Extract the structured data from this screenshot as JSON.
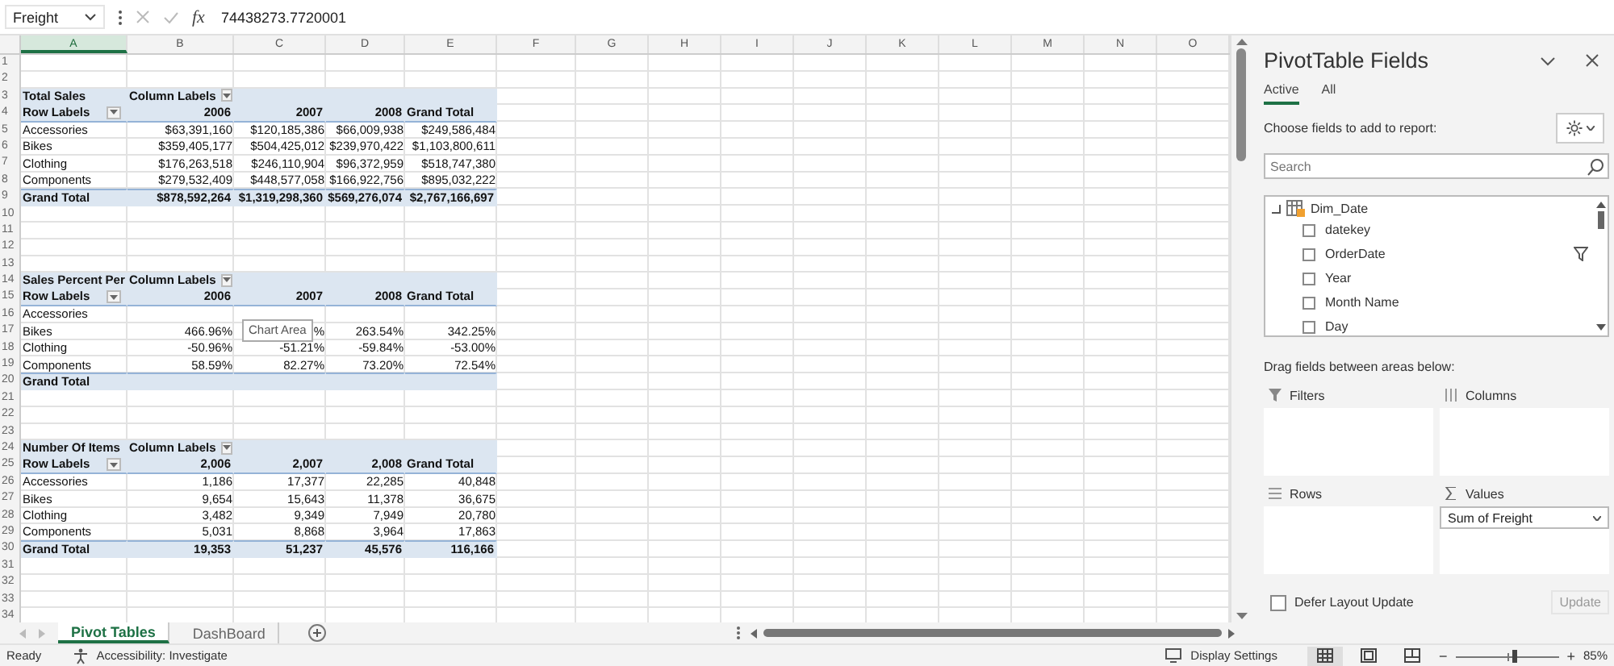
{
  "formula_bar": {
    "name_box": "Freight",
    "function_label": "fx",
    "value": "74438273.7720001"
  },
  "columns": [
    {
      "label": "A",
      "selected": true
    },
    {
      "label": "B",
      "selected": false
    },
    {
      "label": "C",
      "selected": false
    },
    {
      "label": "D",
      "selected": false
    },
    {
      "label": "E",
      "selected": false
    },
    {
      "label": "F",
      "selected": false
    },
    {
      "label": "G",
      "selected": false
    },
    {
      "label": "H",
      "selected": false
    },
    {
      "label": "I",
      "selected": false
    },
    {
      "label": "J",
      "selected": false
    },
    {
      "label": "K",
      "selected": false
    },
    {
      "label": "L",
      "selected": false
    },
    {
      "label": "M",
      "selected": false
    },
    {
      "label": "N",
      "selected": false
    },
    {
      "label": "O",
      "selected": false
    }
  ],
  "rows": [
    {
      "number": "1",
      "kind": "empty",
      "cells": []
    },
    {
      "number": "2",
      "kind": "empty",
      "cells": []
    },
    {
      "number": "3",
      "kind": "title",
      "cells": [
        "Total Sales",
        {
          "text": "Column Labels",
          "filter": true
        }
      ]
    },
    {
      "number": "4",
      "kind": "header",
      "cells": [
        {
          "text": "Row Labels",
          "filter": true
        },
        "2006",
        "2007",
        "2008",
        "Grand Total"
      ]
    },
    {
      "number": "5",
      "kind": "data",
      "cells": [
        "Accessories",
        "$63,391,160",
        "$120,185,386",
        "$66,009,938",
        "$249,586,484"
      ]
    },
    {
      "number": "6",
      "kind": "data",
      "cells": [
        "Bikes",
        "$359,405,177",
        "$504,425,012",
        "$239,970,422",
        "$1,103,800,611"
      ]
    },
    {
      "number": "7",
      "kind": "data",
      "cells": [
        "Clothing",
        "$176,263,518",
        "$246,110,904",
        "$96,372,959",
        "$518,747,380"
      ]
    },
    {
      "number": "8",
      "kind": "data",
      "cells": [
        "Components",
        "$279,532,409",
        "$448,577,058",
        "$166,922,756",
        "$895,032,222"
      ]
    },
    {
      "number": "9",
      "kind": "total",
      "cells": [
        "Grand Total",
        "$878,592,264",
        "$1,319,298,360",
        "$569,276,074",
        "$2,767,166,697"
      ]
    },
    {
      "number": "10",
      "kind": "empty",
      "cells": []
    },
    {
      "number": "11",
      "kind": "empty",
      "cells": []
    },
    {
      "number": "12",
      "kind": "empty",
      "cells": []
    },
    {
      "number": "13",
      "kind": "empty",
      "cells": []
    },
    {
      "number": "14",
      "kind": "title",
      "cells": [
        "Sales Percent Per",
        {
          "text": "Column Labels",
          "filter": true
        }
      ]
    },
    {
      "number": "15",
      "kind": "header",
      "cells": [
        {
          "text": "Row Labels",
          "filter": true
        },
        "2006",
        "2007",
        "2008",
        "Grand Total"
      ]
    },
    {
      "number": "16",
      "kind": "data",
      "cells": [
        "Accessories"
      ]
    },
    {
      "number": "17",
      "kind": "data",
      "cells": [
        "Bikes",
        "466.96%",
        "%",
        "263.54%",
        "342.25%"
      ]
    },
    {
      "number": "18",
      "kind": "data",
      "cells": [
        "Clothing",
        "-50.96%",
        "-51.21%",
        "-59.84%",
        "-53.00%"
      ]
    },
    {
      "number": "19",
      "kind": "data",
      "cells": [
        "Components",
        "58.59%",
        "82.27%",
        "73.20%",
        "72.54%"
      ]
    },
    {
      "number": "20",
      "kind": "total",
      "cells": [
        "Grand Total"
      ]
    },
    {
      "number": "21",
      "kind": "empty",
      "cells": []
    },
    {
      "number": "22",
      "kind": "empty",
      "cells": []
    },
    {
      "number": "23",
      "kind": "empty",
      "cells": []
    },
    {
      "number": "24",
      "kind": "title",
      "cells": [
        "Number Of Items",
        {
          "text": "Column Labels",
          "filter": true
        }
      ]
    },
    {
      "number": "25",
      "kind": "header",
      "cells": [
        {
          "text": "Row Labels",
          "filter": true
        },
        "2,006",
        "2,007",
        "2,008",
        "Grand Total"
      ]
    },
    {
      "number": "26",
      "kind": "data",
      "cells": [
        "Accessories",
        "1,186",
        "17,377",
        "22,285",
        "40,848"
      ]
    },
    {
      "number": "27",
      "kind": "data",
      "cells": [
        "Bikes",
        "9,654",
        "15,643",
        "11,378",
        "36,675"
      ]
    },
    {
      "number": "28",
      "kind": "data",
      "cells": [
        "Clothing",
        "3,482",
        "9,349",
        "7,949",
        "20,780"
      ]
    },
    {
      "number": "29",
      "kind": "data",
      "cells": [
        "Components",
        "5,031",
        "8,868",
        "3,964",
        "17,863"
      ]
    },
    {
      "number": "30",
      "kind": "total",
      "cells": [
        "Grand Total",
        "19,353",
        "51,237",
        "45,576",
        "116,166"
      ]
    },
    {
      "number": "31",
      "kind": "empty",
      "cells": []
    },
    {
      "number": "32",
      "kind": "empty",
      "cells": []
    },
    {
      "number": "33",
      "kind": "empty",
      "cells": []
    },
    {
      "number": "34",
      "kind": "empty",
      "cells": []
    }
  ],
  "tooltip": "Chart Area",
  "sheet_tabs": [
    {
      "label": "Pivot Tables",
      "selected": true
    },
    {
      "label": "DashBoard",
      "selected": false
    }
  ],
  "pane": {
    "title": "PivotTable Fields",
    "tabs": [
      {
        "label": "Active",
        "selected": true
      },
      {
        "label": "All",
        "selected": false
      }
    ],
    "choose_label": "Choose fields to add to report:",
    "search": {
      "placeholder": "Search"
    },
    "fields": [
      {
        "label": "Dim_Date",
        "kind": "table",
        "expanded": true
      },
      {
        "label": "datekey",
        "kind": "field",
        "checked": false,
        "filtered": false
      },
      {
        "label": "OrderDate",
        "kind": "field",
        "checked": false,
        "filtered": true
      },
      {
        "label": "Year",
        "kind": "field",
        "checked": false,
        "filtered": false
      },
      {
        "label": "Month Name",
        "kind": "field",
        "checked": false,
        "filtered": false
      },
      {
        "label": "Day",
        "kind": "field",
        "checked": false,
        "filtered": false
      }
    ],
    "drag_label": "Drag fields between areas below:",
    "areas": [
      {
        "kind": "filters",
        "label": "Filters"
      },
      {
        "kind": "columns",
        "label": "Columns"
      },
      {
        "kind": "rows",
        "label": "Rows"
      },
      {
        "kind": "values",
        "label": "Values",
        "items": [
          "Sum of Freight"
        ]
      }
    ],
    "defer": {
      "label": "Defer Layout Update",
      "checked": false
    },
    "update": {
      "label": "Update",
      "disabled": true
    }
  },
  "status_bar": {
    "mode": "Ready",
    "accessibility": "Accessibility: Investigate",
    "display_settings": "Display Settings",
    "zoom": {
      "level": 0.57,
      "label": "85%",
      "zoom_out": "−",
      "zoom_in": "+"
    }
  }
}
